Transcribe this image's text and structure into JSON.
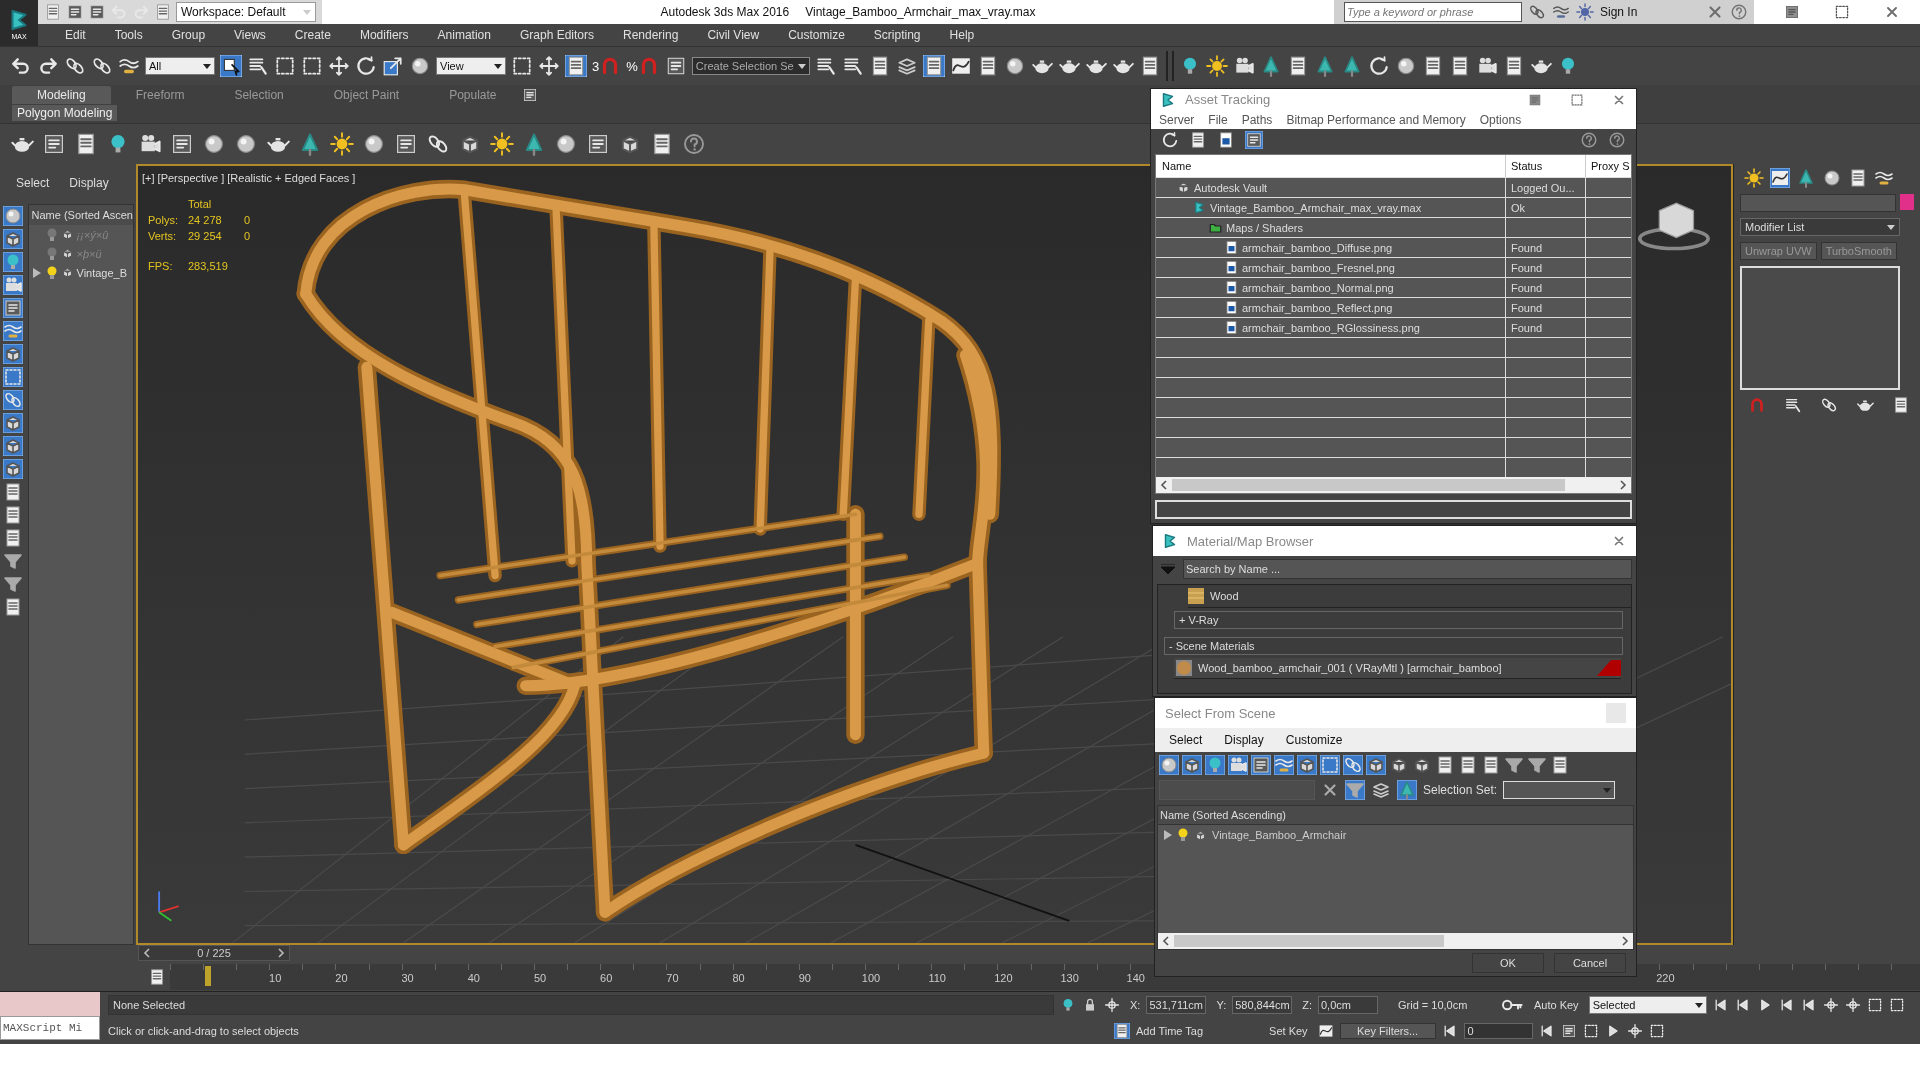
{
  "app_title": {
    "product": "Autodesk 3ds Max 2016",
    "file": "Vintage_Bamboo_Armchair_max_vray.max",
    "logo": "MAX"
  },
  "workspace": "Workspace: Default",
  "search": {
    "placeholder": "Type a keyword or phrase"
  },
  "sign_in": "Sign In",
  "menu": [
    "Edit",
    "Tools",
    "Group",
    "Views",
    "Create",
    "Modifiers",
    "Animation",
    "Graph Editors",
    "Rendering",
    "Civil View",
    "Customize",
    "Scripting",
    "Help"
  ],
  "toolbar": {
    "selection_filter": "All",
    "ref_coord": "View",
    "snap_dimension": "3",
    "percent_snap": "%",
    "named_selection": "Create Selection Se"
  },
  "ribbon": {
    "tabs": [
      {
        "label": "Modeling",
        "selected": true
      },
      {
        "label": "Freeform",
        "selected": false
      },
      {
        "label": "Selection",
        "selected": false
      },
      {
        "label": "Object Paint",
        "selected": false
      },
      {
        "label": "Populate",
        "selected": false
      }
    ],
    "panel": "Polygon Modeling"
  },
  "scene_explorer": {
    "tabs": [
      "Select",
      "Display"
    ],
    "column": "Name (Sorted Ascen",
    "items": [
      {
        "name": "¡¡×ý×û",
        "hidden": true,
        "expandable": false
      },
      {
        "name": "×þ×ü",
        "hidden": true,
        "expandable": false
      },
      {
        "name": "Vintage_B",
        "hidden": false,
        "expandable": true
      }
    ]
  },
  "viewport": {
    "label": "[+] [Perspective ] [Realistic + Edged Faces ]",
    "stats": {
      "header": "Total",
      "rows": [
        {
          "label": "Polys:",
          "total": "24 278",
          "selected": "0"
        },
        {
          "label": "Verts:",
          "total": "29 254",
          "selected": "0"
        }
      ],
      "fps_label": "FPS:",
      "fps": "283,519"
    }
  },
  "asset_tracking": {
    "title": "Asset Tracking",
    "menu": [
      "Server",
      "File",
      "Paths",
      "Bitmap Performance and Memory",
      "Options"
    ],
    "columns": [
      "Name",
      "Status",
      "Proxy S"
    ],
    "tree": [
      {
        "name": "Autodesk Vault",
        "status": "Logged Ou...",
        "kind": "vault",
        "children": [
          {
            "name": "Vintage_Bamboo_Armchair_max_vray.max",
            "status": "Ok",
            "kind": "scene_file",
            "children": [
              {
                "name": "Maps / Shaders",
                "kind": "folder",
                "children": [
                  {
                    "name": "armchair_bamboo_Diffuse.png",
                    "status": "Found",
                    "kind": "image"
                  },
                  {
                    "name": "armchair_bamboo_Fresnel.png",
                    "status": "Found",
                    "kind": "image"
                  },
                  {
                    "name": "armchair_bamboo_Normal.png",
                    "status": "Found",
                    "kind": "image"
                  },
                  {
                    "name": "armchair_bamboo_Reflect.png",
                    "status": "Found",
                    "kind": "image"
                  },
                  {
                    "name": "armchair_bamboo_RGlossiness.png",
                    "status": "Found",
                    "kind": "image"
                  }
                ]
              }
            ]
          }
        ]
      }
    ]
  },
  "material_browser": {
    "title": "Material/Map Browser",
    "search": {
      "placeholder": "Search by Name ..."
    },
    "library": "Wood",
    "groups": [
      {
        "sign": "+",
        "label": "V-Ray"
      },
      {
        "sign": "-",
        "label": "Scene Materials"
      }
    ],
    "scene_material": "Wood_bamboo_armchair_001  ( VRayMtl ) [armchair_bamboo]"
  },
  "select_from_scene": {
    "title": "Select From Scene",
    "menu": [
      "Select",
      "Display",
      "Customize"
    ],
    "selection_set_label": "Selection Set:",
    "column": "Name (Sorted Ascending)",
    "items": [
      {
        "name": "Vintage_Bamboo_Armchair",
        "expanded": false
      }
    ],
    "buttons": [
      "OK",
      "Cancel"
    ]
  },
  "command_panel": {
    "modifier_list": "Modifier List",
    "buttons": [
      "Unwrap UVW",
      "TurboSmooth"
    ]
  },
  "timeline": {
    "position": "0 / 225",
    "ticks": [
      "10",
      "20",
      "30",
      "40",
      "50",
      "60",
      "70",
      "80",
      "90",
      "100",
      "110",
      "120",
      "130",
      "140",
      "220"
    ]
  },
  "status": {
    "maxscript": "MAXScript Mi",
    "selection": "None Selected",
    "prompt": "Click or click-and-drag to select objects",
    "coords": [
      {
        "axis": "X:",
        "value": "531,711cm"
      },
      {
        "axis": "Y:",
        "value": "580,844cm"
      },
      {
        "axis": "Z:",
        "value": "0,0cm"
      }
    ],
    "grid": "Grid = 10,0cm",
    "add_time_tag": "Add Time Tag",
    "auto_key": "Auto Key",
    "set_key": "Set Key",
    "key_mode": "Selected",
    "key_filters": "Key Filters...",
    "frame": "0"
  }
}
